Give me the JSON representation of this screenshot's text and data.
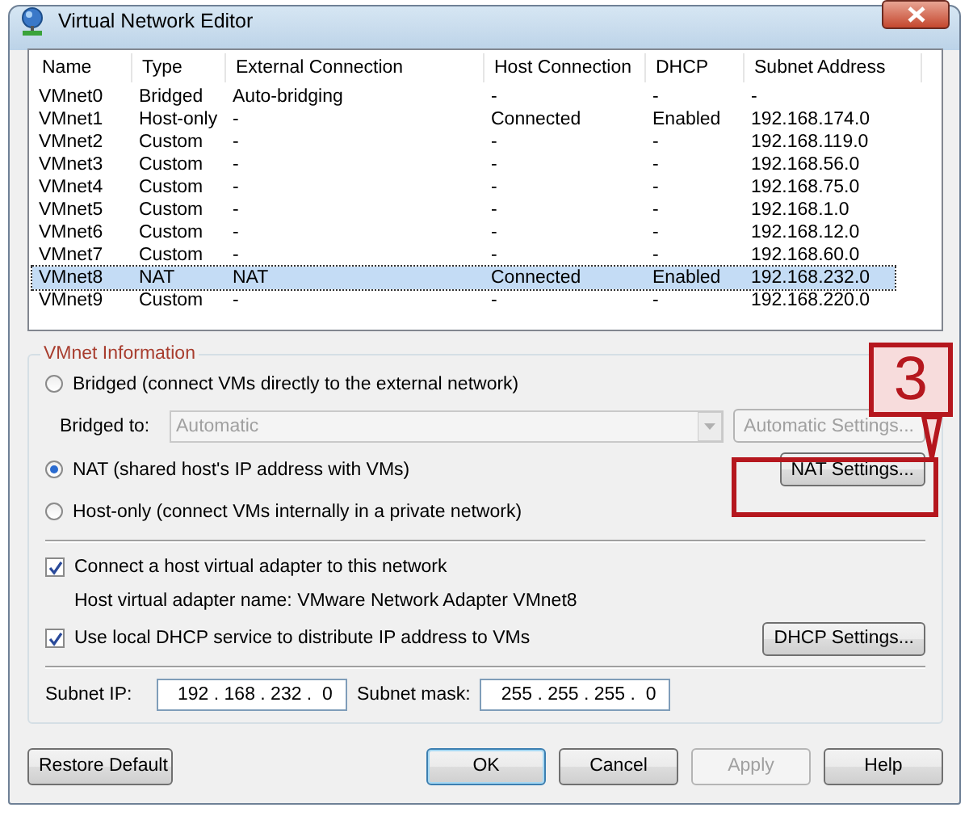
{
  "window": {
    "title": "Virtual Network Editor"
  },
  "table": {
    "columns": [
      "Name",
      "Type",
      "External Connection",
      "Host Connection",
      "DHCP",
      "Subnet Address"
    ],
    "rows": [
      {
        "cells": [
          "VMnet0",
          "Bridged",
          "Auto-bridging",
          "-",
          "-",
          "-"
        ],
        "selected": false
      },
      {
        "cells": [
          "VMnet1",
          "Host-only",
          "-",
          "Connected",
          "Enabled",
          "192.168.174.0"
        ],
        "selected": false
      },
      {
        "cells": [
          "VMnet2",
          "Custom",
          "-",
          "-",
          "-",
          "192.168.119.0"
        ],
        "selected": false
      },
      {
        "cells": [
          "VMnet3",
          "Custom",
          "-",
          "-",
          "-",
          "192.168.56.0"
        ],
        "selected": false
      },
      {
        "cells": [
          "VMnet4",
          "Custom",
          "-",
          "-",
          "-",
          "192.168.75.0"
        ],
        "selected": false
      },
      {
        "cells": [
          "VMnet5",
          "Custom",
          "-",
          "-",
          "-",
          "192.168.1.0"
        ],
        "selected": false
      },
      {
        "cells": [
          "VMnet6",
          "Custom",
          "-",
          "-",
          "-",
          "192.168.12.0"
        ],
        "selected": false
      },
      {
        "cells": [
          "VMnet7",
          "Custom",
          "-",
          "-",
          "-",
          "192.168.60.0"
        ],
        "selected": false
      },
      {
        "cells": [
          "VMnet8",
          "NAT",
          "NAT",
          "Connected",
          "Enabled",
          "192.168.232.0"
        ],
        "selected": true
      },
      {
        "cells": [
          "VMnet9",
          "Custom",
          "-",
          "-",
          "-",
          "192.168.220.0"
        ],
        "selected": false
      }
    ]
  },
  "vmnet_info": {
    "title": "VMnet Information",
    "bridged_radio": {
      "label": "Bridged (connect VMs directly to the external network)",
      "selected": false
    },
    "bridged_to": {
      "label": "Bridged to:",
      "value": "Automatic",
      "disabled": true
    },
    "automatic_settings": {
      "label": "Automatic Settings...",
      "disabled": true
    },
    "nat_radio": {
      "label": "NAT (shared host's IP address with VMs)",
      "selected": true
    },
    "nat_settings": {
      "label": "NAT Settings...",
      "disabled": false
    },
    "host_only_radio": {
      "label": "Host-only (connect VMs internally in a private network)",
      "selected": false
    },
    "connect_adapter": {
      "label": "Connect a host virtual adapter to this network",
      "checked": true
    },
    "adapter_name": "Host virtual adapter name: VMware Network Adapter VMnet8",
    "use_dhcp": {
      "label": "Use local DHCP service to distribute IP address to VMs",
      "checked": true
    },
    "dhcp_settings": {
      "label": "DHCP Settings...",
      "disabled": false
    },
    "subnet_ip": {
      "label": "Subnet IP:",
      "value": "192 . 168 . 232 .  0"
    },
    "subnet_mask": {
      "label": "Subnet mask:",
      "value": "255 . 255 . 255 .  0"
    }
  },
  "buttons": [
    {
      "label": "Restore Default",
      "disabled": false,
      "default": false
    },
    {
      "label": "OK",
      "disabled": false,
      "default": true
    },
    {
      "label": "Cancel",
      "disabled": false,
      "default": false
    },
    {
      "label": "Apply",
      "disabled": true,
      "default": false
    },
    {
      "label": "Help",
      "disabled": false,
      "default": false
    }
  ],
  "annotation": {
    "label": "3"
  }
}
